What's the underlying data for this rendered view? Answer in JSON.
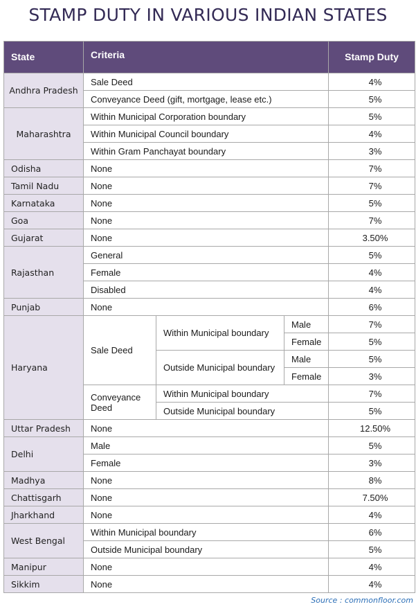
{
  "title": "STAMP DUTY IN VARIOUS INDIAN STATES",
  "colors": {
    "header_bg": "#5f4b7b",
    "state_bg": "#e5e0ec",
    "title": "#332a55",
    "source": "#2c6fb7"
  },
  "headers": {
    "state": "State",
    "criteria": "Criteria",
    "stamp_duty": "Stamp Duty"
  },
  "rows": {
    "andhra": {
      "state": "Andhra Pradesh",
      "items": [
        {
          "criteria": "Sale Deed",
          "duty": "4%"
        },
        {
          "criteria": "Conveyance Deed (gift, mortgage, lease etc.)",
          "duty": "5%"
        }
      ]
    },
    "maharashtra": {
      "state": "Maharashtra",
      "items": [
        {
          "criteria": "Within Municipal Corporation boundary",
          "duty": "5%"
        },
        {
          "criteria": "Within Municipal Council boundary",
          "duty": "4%"
        },
        {
          "criteria": "Within Gram Panchayat boundary",
          "duty": "3%"
        }
      ]
    },
    "odisha": {
      "state": "Odisha",
      "criteria": "None",
      "duty": "7%"
    },
    "tamilnadu": {
      "state": "Tamil Nadu",
      "criteria": "None",
      "duty": "7%"
    },
    "karnataka": {
      "state": "Karnataka",
      "criteria": "None",
      "duty": "5%"
    },
    "goa": {
      "state": "Goa",
      "criteria": "None",
      "duty": "7%"
    },
    "gujarat": {
      "state": "Gujarat",
      "criteria": "None",
      "duty": "3.50%"
    },
    "rajasthan": {
      "state": "Rajasthan",
      "items": [
        {
          "criteria": "General",
          "duty": "5%"
        },
        {
          "criteria": "Female",
          "duty": "4%"
        },
        {
          "criteria": "Disabled",
          "duty": "4%"
        }
      ]
    },
    "punjab": {
      "state": "Punjab",
      "criteria": "None",
      "duty": "6%"
    },
    "haryana": {
      "state": "Haryana",
      "sale_deed": {
        "label": "Sale Deed",
        "within": {
          "label": "Within Municipal boundary",
          "male": {
            "label": "Male",
            "duty": "7%"
          },
          "female": {
            "label": "Female",
            "duty": "5%"
          }
        },
        "outside": {
          "label": "Outside Municipal boundary",
          "male": {
            "label": "Male",
            "duty": "5%"
          },
          "female": {
            "label": "Female",
            "duty": "3%"
          }
        }
      },
      "conveyance_deed": {
        "label": "Conveyance Deed",
        "within": {
          "label": "Within Municipal boundary",
          "duty": "7%"
        },
        "outside": {
          "label": "Outside Municipal boundary",
          "duty": "5%"
        }
      }
    },
    "uttarpradesh": {
      "state": "Uttar Pradesh",
      "criteria": "None",
      "duty": "12.50%"
    },
    "delhi": {
      "state": "Delhi",
      "items": [
        {
          "criteria": "Male",
          "duty": "5%"
        },
        {
          "criteria": "Female",
          "duty": "3%"
        }
      ]
    },
    "madhya": {
      "state": "Madhya",
      "criteria": "None",
      "duty": "8%"
    },
    "chattisgarh": {
      "state": "Chattisgarh",
      "criteria": "None",
      "duty": "7.50%"
    },
    "jharkhand": {
      "state": "Jharkhand",
      "criteria": "None",
      "duty": "4%"
    },
    "westbengal": {
      "state": "West Bengal",
      "items": [
        {
          "criteria": "Within Municipal boundary",
          "duty": "6%"
        },
        {
          "criteria": "Outside Municipal boundary",
          "duty": "5%"
        }
      ]
    },
    "manipur": {
      "state": "Manipur",
      "criteria": "None",
      "duty": "4%"
    },
    "sikkim": {
      "state": "Sikkim",
      "criteria": "None",
      "duty": "4%"
    }
  },
  "source": "Source : commonfloor.com"
}
